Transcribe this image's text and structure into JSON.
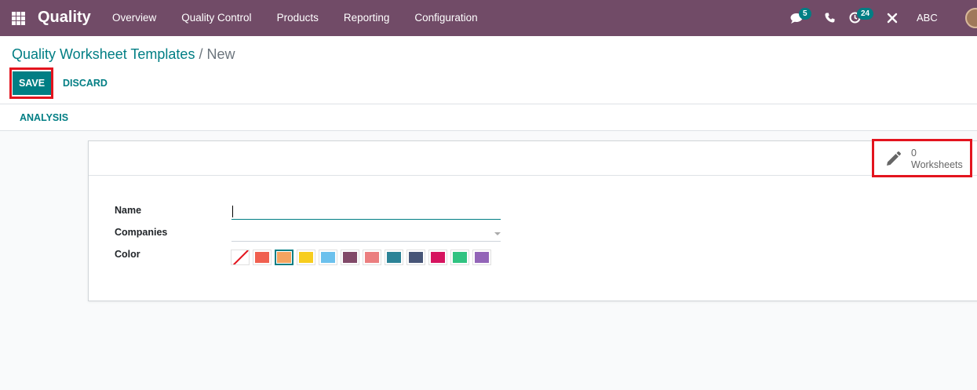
{
  "app": {
    "name": "Quality"
  },
  "menu": [
    "Overview",
    "Quality Control",
    "Products",
    "Reporting",
    "Configuration"
  ],
  "systray": {
    "messages_count": "5",
    "activities_count": "24",
    "user_name": "ABC"
  },
  "breadcrumb": {
    "parent": "Quality Worksheet Templates",
    "separator": "/",
    "current": "New"
  },
  "buttons": {
    "save": "SAVE",
    "discard": "DISCARD",
    "analysis": "ANALYSIS"
  },
  "stat_button": {
    "value": "0",
    "label": "Worksheets",
    "icon": "pencil-icon"
  },
  "form": {
    "name_label": "Name",
    "name_value": "",
    "companies_label": "Companies",
    "companies_value": "",
    "color_label": "Color",
    "colors": [
      "none",
      "#f06050",
      "#f4a460",
      "#f7cd1f",
      "#6cc1ed",
      "#814968",
      "#eb7e7f",
      "#2c8397",
      "#475577",
      "#d6145f",
      "#30c381",
      "#9365b8"
    ],
    "selected_color_index": 2
  },
  "accent_color": "#017e84",
  "navbar_color": "#714b67"
}
